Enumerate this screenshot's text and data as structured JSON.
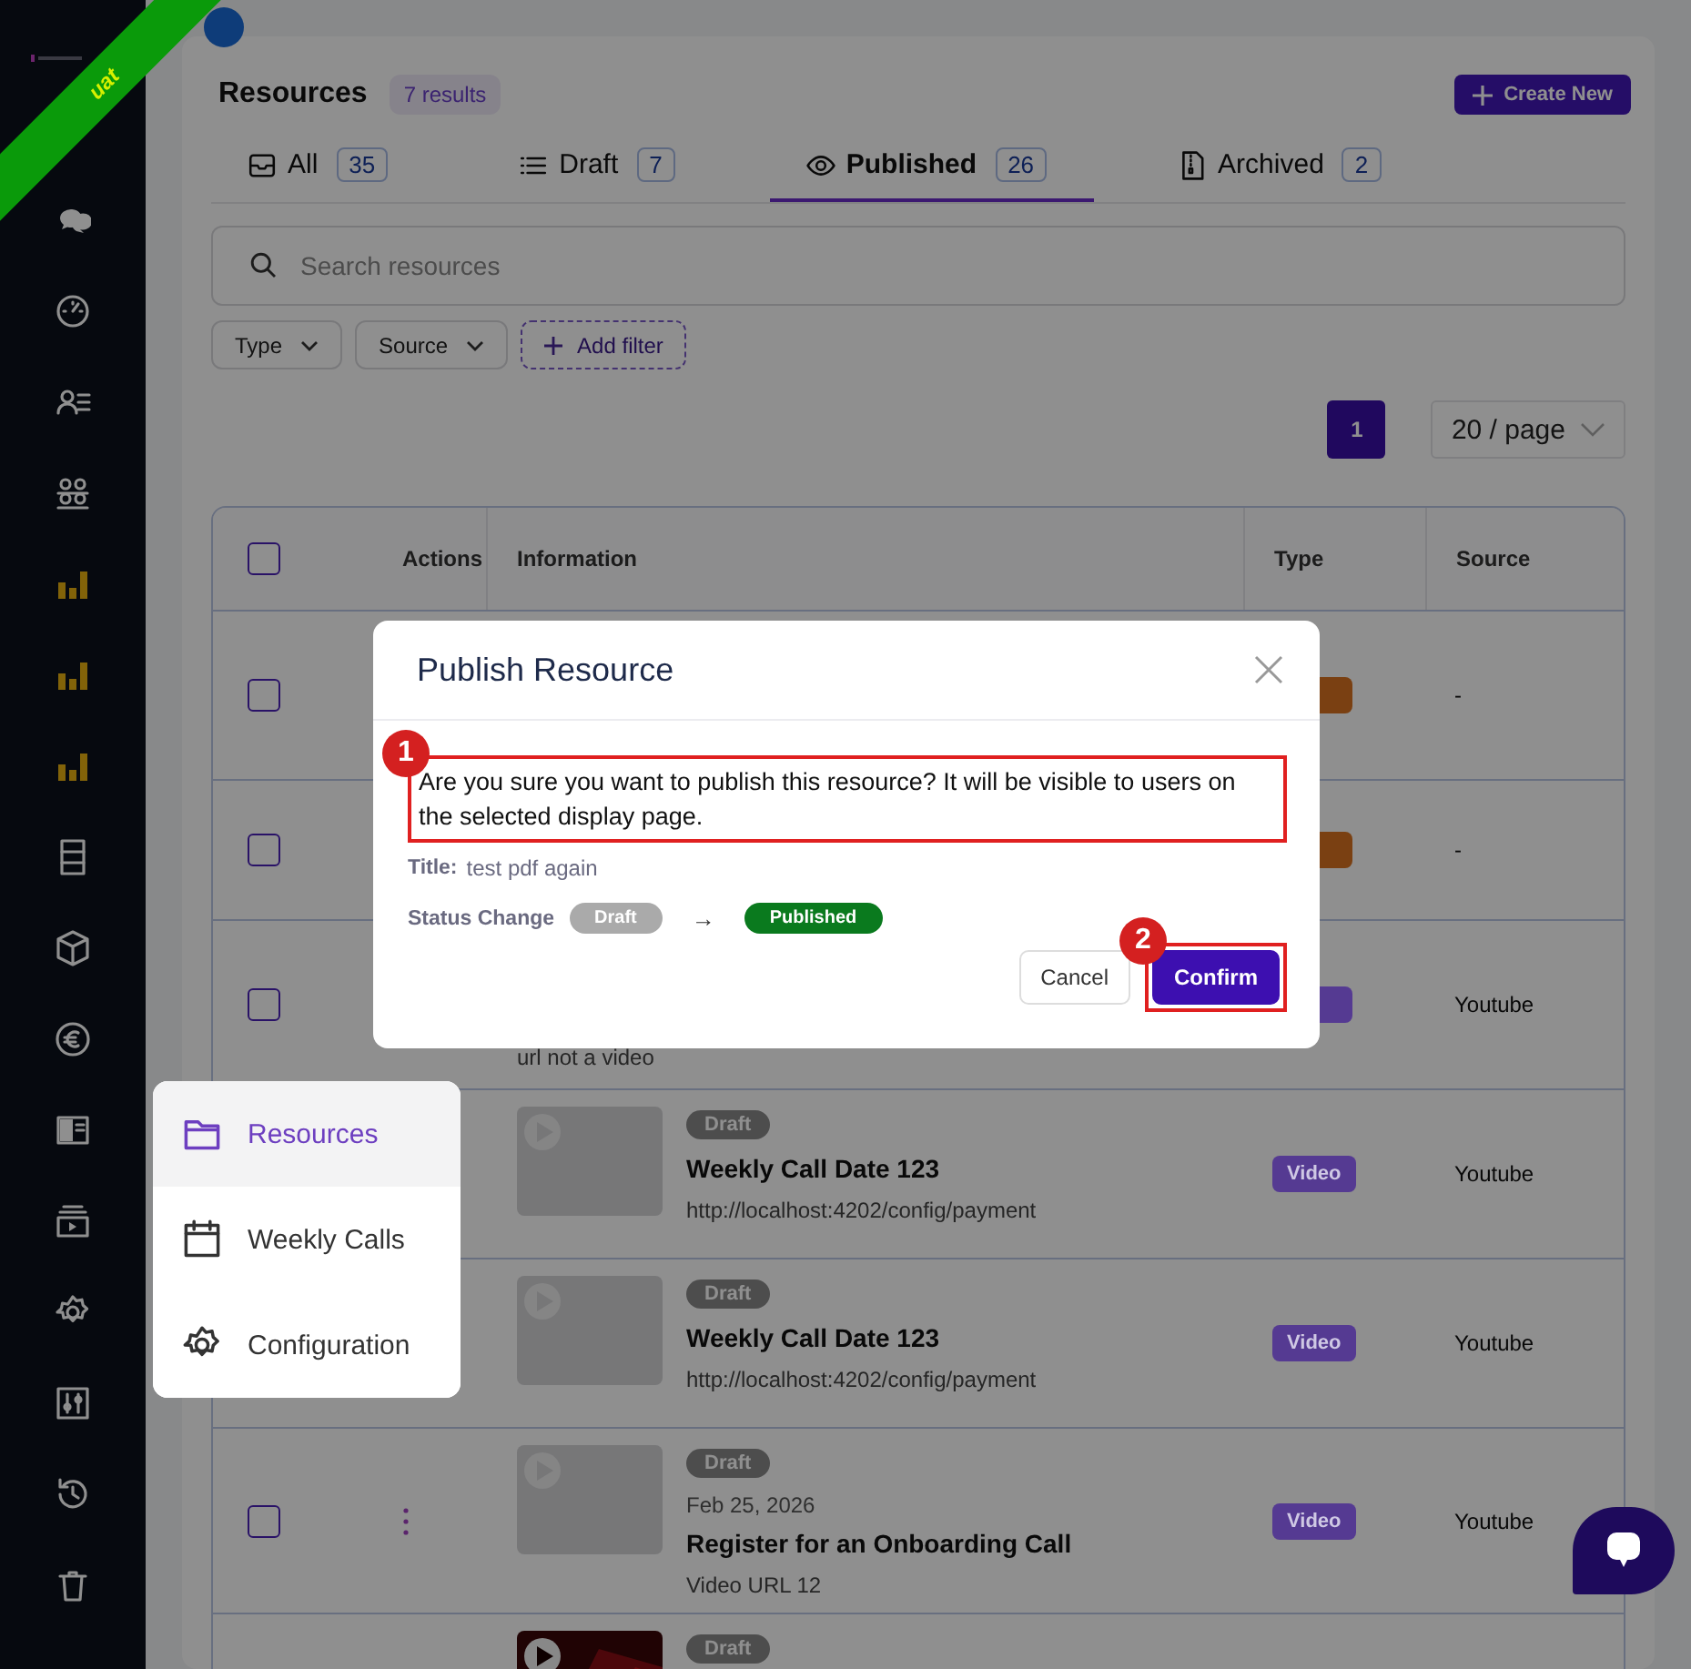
{
  "sidebar": {
    "badge": "uat"
  },
  "page": {
    "title": "Resources",
    "result_count": "7 results",
    "create_button": "Create New"
  },
  "tabs": [
    {
      "label": "All",
      "count": "35",
      "selected": false,
      "kind": "all"
    },
    {
      "label": "Draft",
      "count": "7",
      "selected": false,
      "kind": "draft"
    },
    {
      "label": "Published",
      "count": "26",
      "selected": true,
      "kind": "published"
    },
    {
      "label": "Archived",
      "count": "2",
      "selected": false,
      "kind": "archived"
    }
  ],
  "search": {
    "placeholder": "Search resources"
  },
  "filters": [
    {
      "label": "Type",
      "kind": "dropdown"
    },
    {
      "label": "Source",
      "kind": "dropdown"
    },
    {
      "label": "Add filter",
      "kind": "add"
    }
  ],
  "pagination": {
    "pages": [
      {
        "label": "1",
        "selected": true
      }
    ],
    "page_size": "20 / page"
  },
  "table": {
    "all_checked": false,
    "columns": [
      "Actions",
      "Information",
      "Type",
      "Source"
    ],
    "rows": [
      {
        "checked": false,
        "type": {
          "color": "#7a4012"
        },
        "source": "-"
      },
      {
        "checked": false,
        "type": {
          "color": "#7a4012"
        },
        "source": "-"
      },
      {
        "checked": false,
        "url": "url not a video",
        "type": {
          "color": "#553a92"
        },
        "source": "Youtube"
      },
      {
        "thumbnail": {
          "kind": "placeholder"
        },
        "status": "Draft",
        "title": "Weekly Call Date 123",
        "url": "http://localhost:4202/config/payment",
        "type": {
          "label": "Video",
          "color": "#553a92"
        },
        "source": "Youtube"
      },
      {
        "thumbnail": {
          "kind": "placeholder"
        },
        "status": "Draft",
        "title": "Weekly Call Date 123",
        "url": "http://localhost:4202/config/payment",
        "type": {
          "label": "Video",
          "color": "#553a92"
        },
        "source": "Youtube"
      },
      {
        "checked": false,
        "actions_menu": true,
        "thumbnail": {
          "kind": "placeholder"
        },
        "status": "Draft",
        "date": "Feb 25, 2026",
        "title": "Register for an Onboarding Call",
        "url": "Video URL 12",
        "type": {
          "label": "Video",
          "color": "#553a92"
        },
        "source": "Youtube"
      },
      {
        "status": "Draft"
      }
    ]
  },
  "modal": {
    "title": "Publish Resource",
    "message": "Are you sure you want to publish this resource? It will be visible to users on the selected display page.",
    "message_marker": "1",
    "title_label": "Title:",
    "title_value": "test pdf again",
    "status_label": "Status Change",
    "from_status": "Draft",
    "arrow": "→",
    "to_status": "Published",
    "buttons": [
      {
        "label": "Cancel",
        "kind": "secondary"
      },
      {
        "label": "Confirm",
        "kind": "primary",
        "marker": "2"
      }
    ]
  },
  "menu": {
    "items": [
      {
        "label": "Resources",
        "selected": true,
        "kind": "folder"
      },
      {
        "label": "Weekly Calls",
        "selected": false,
        "kind": "calendar"
      },
      {
        "label": "Configuration",
        "selected": false,
        "kind": "gear"
      }
    ]
  }
}
